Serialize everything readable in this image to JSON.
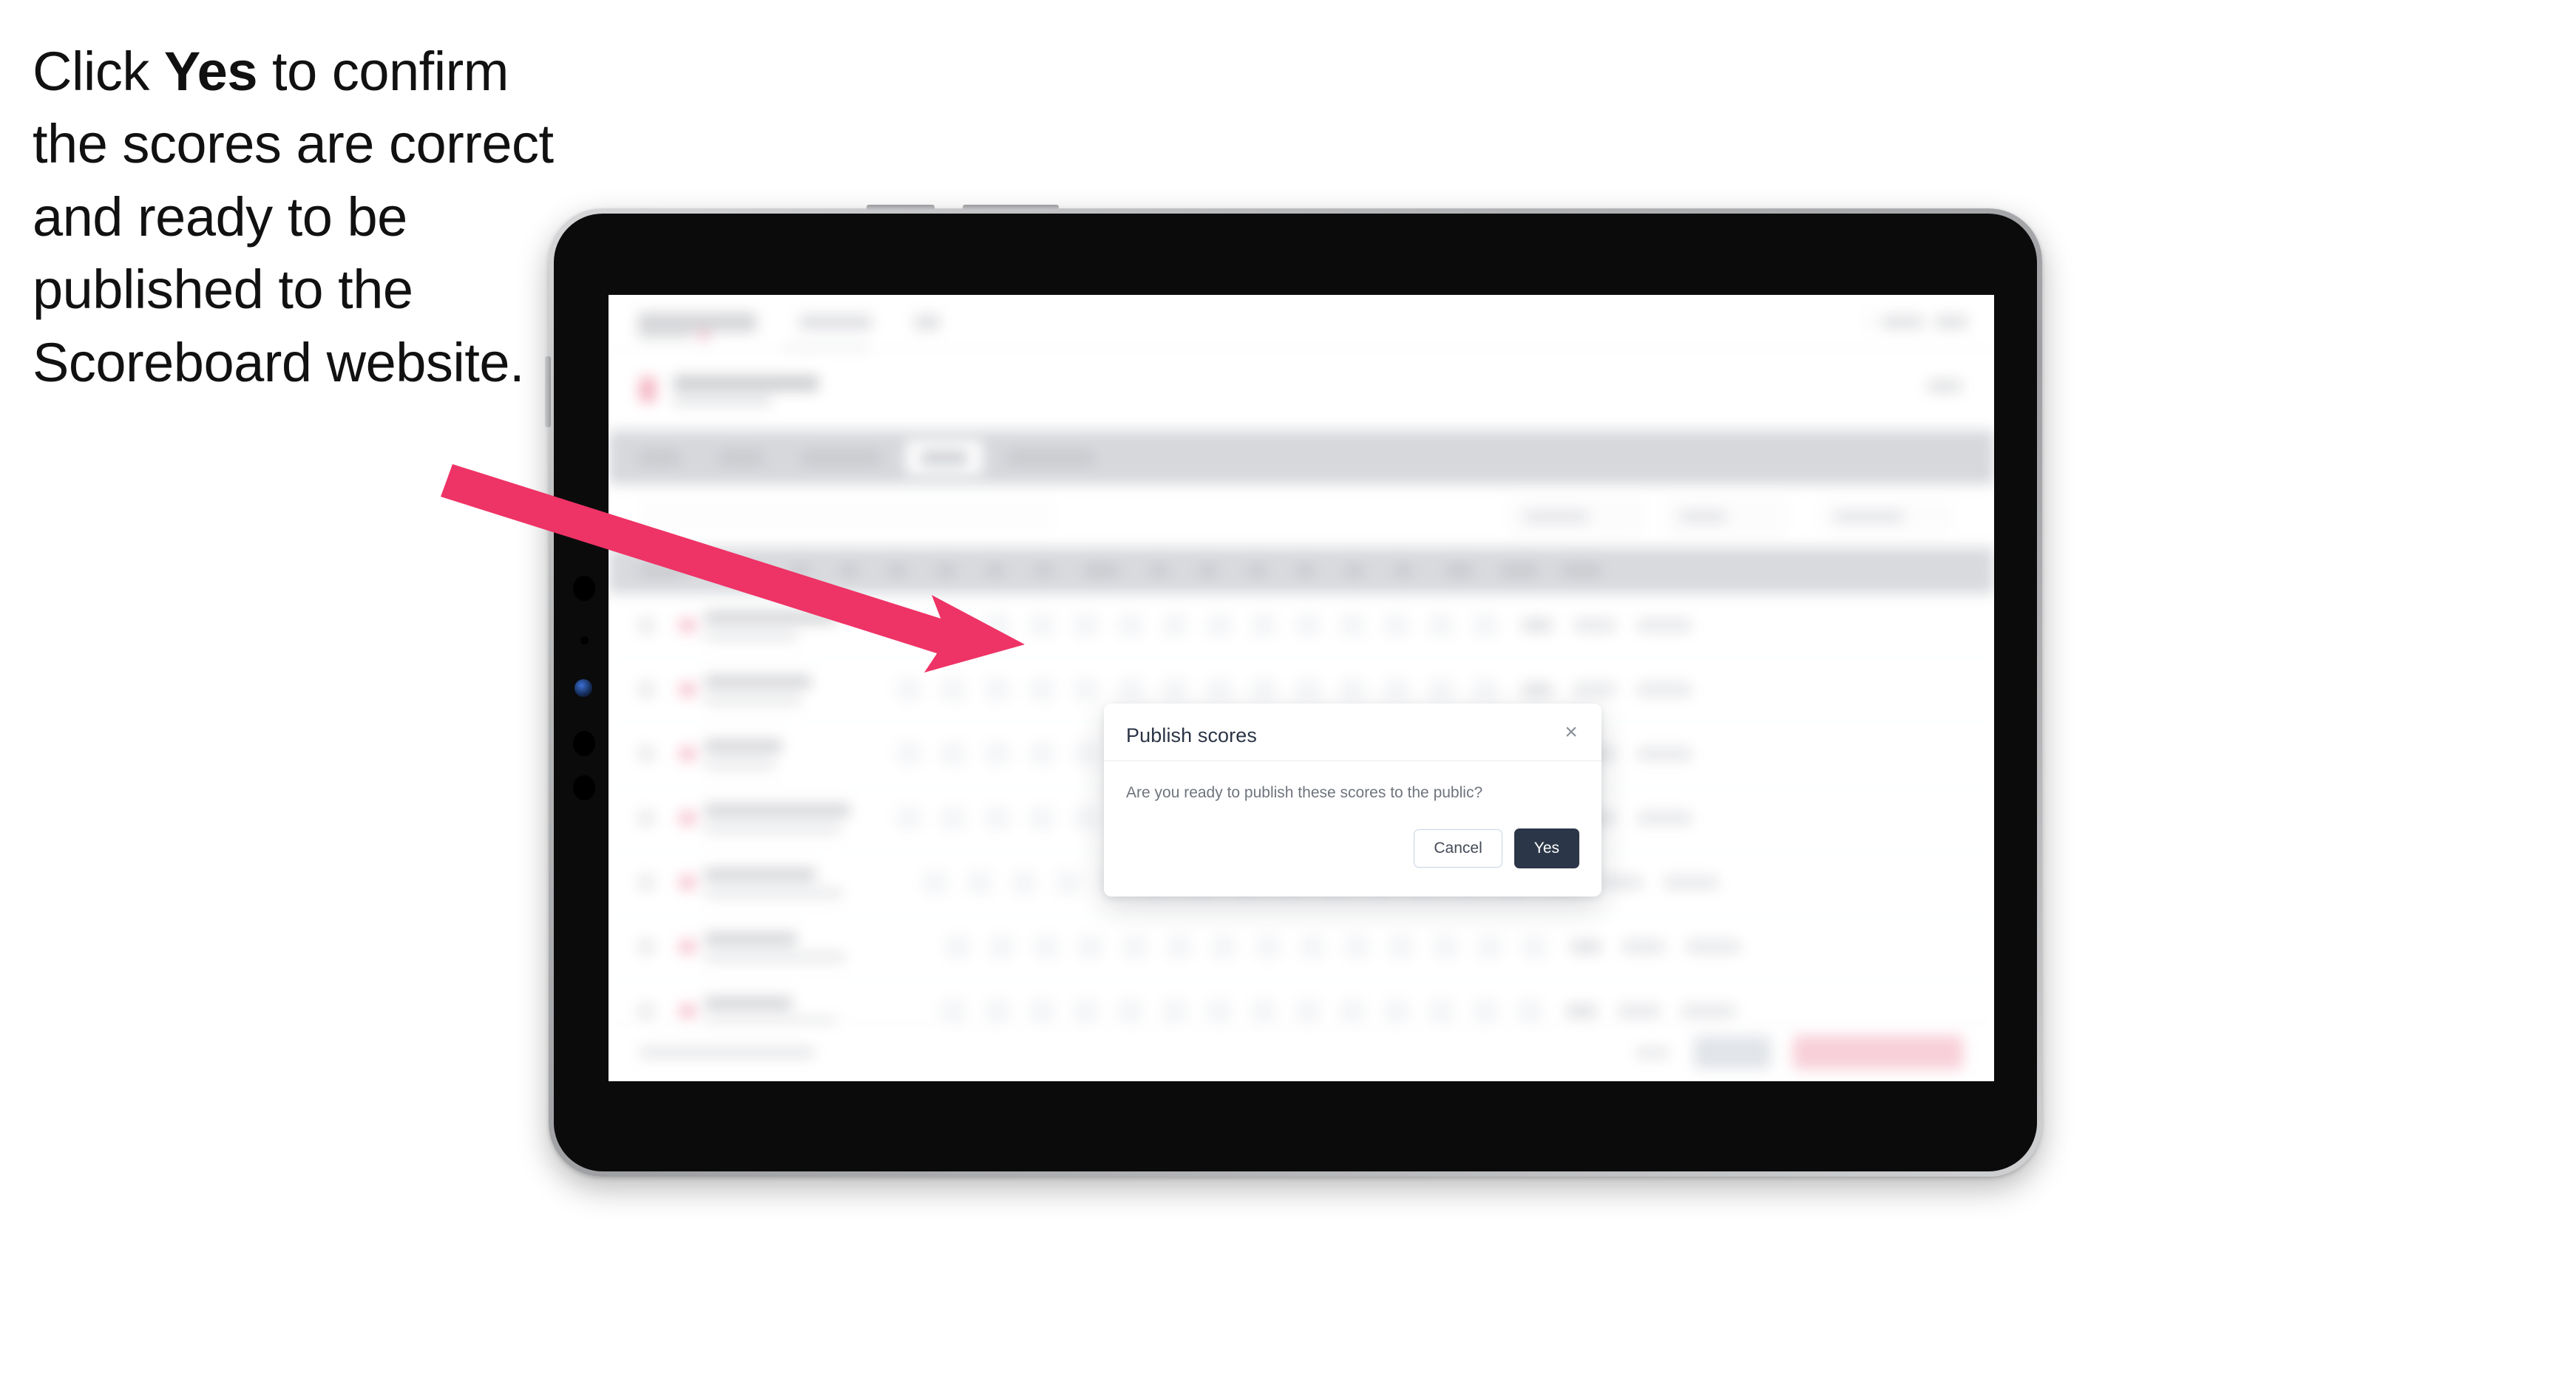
{
  "instruction": {
    "prefix": "Click ",
    "emphasis": "Yes",
    "suffix": " to confirm the scores are correct and ready to be published to the Scoreboard website."
  },
  "dialog": {
    "title": "Publish scores",
    "message": "Are you ready to publish these scores to the public?",
    "close_icon": "×",
    "cancel_label": "Cancel",
    "confirm_label": "Yes"
  },
  "colors": {
    "arrow": "#EE3366",
    "confirm_button_bg": "#2B3748",
    "cancel_button_border": "#C6D3E4",
    "dialog_title": "#2B3445",
    "dialog_message": "#6F747D",
    "tablet_body": "#0B0B0C",
    "tablet_bezel": "#BABBBD",
    "app_tabstrip": "#D3D5D9",
    "app_table_header": "#D5D7DB",
    "footer_primary_button": "#F8CCD6",
    "footer_secondary_button": "#DFE2E7"
  },
  "device": {
    "type": "tablet",
    "orientation": "landscape"
  },
  "background_app": {
    "note": "blurred behind modal",
    "tab_count": 5,
    "active_tab_index": 3,
    "row_count": 7,
    "score_columns_per_row": 17
  }
}
